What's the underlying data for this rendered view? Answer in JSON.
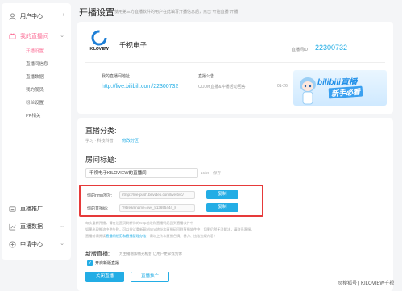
{
  "sidebar": {
    "groups": [
      {
        "label": "用户中心",
        "icon": "user-icon"
      },
      {
        "label": "我的直播间",
        "icon": "live-room-icon"
      }
    ],
    "sub_items": [
      "开播设置",
      "直播间信息",
      "直播数据",
      "我的舰员",
      "粉丝设置",
      "PK相关"
    ],
    "bottom_groups": [
      {
        "label": "直播推广",
        "icon": "promotion-icon"
      },
      {
        "label": "直播数据",
        "icon": "data-icon"
      },
      {
        "label": "申请中心",
        "icon": "apply-icon"
      }
    ]
  },
  "page": {
    "title": "开播设置",
    "desc": "使用第三方直播软件的用户在此填写开播信息后，点击“开始直播”开播"
  },
  "room": {
    "logo_text": "KILOVIEW",
    "name": "千视电子",
    "id_label": "直播间ID",
    "id": "22300732",
    "addr_label": "我的直播间地址",
    "addr": "http://live.bilibili.com/22300732",
    "notice_label": "直播公告",
    "notice_value": "CODM直播&冲播活动回答",
    "date": "01-26",
    "banner_title": "bilibili直播",
    "banner_sub": "新手必看"
  },
  "form": {
    "category_title": "直播分类:",
    "category_value": "学习 · 科技科普",
    "category_link": "修改分区",
    "room_title_label": "房间标题:",
    "room_title_value": "千视电子KILOVIEW的直播间",
    "title_count": "16/20",
    "title_save": "保存",
    "rtmp_label": "你的rtmp地址:",
    "rtmp_value": "rtmp://live-push.bilivideo.com/live-bvc/",
    "key_label": "你的直播码:",
    "key_value": "?streamname=live_513695444_8",
    "copy_label": "复制",
    "note1": "每次重新开播，请在设置页刷新你的rtmp地址和直播码后回到直播软件中",
    "note2": "如果出现推流中途失败，可以尝试重新复制rtmp地址和直播码回到直播软件中，如果仍然无法解决，请联系客服。",
    "note3_pre": "直播前请阅读",
    "note3_link": "直播间规范和直播管理办法",
    "note3_post": "，请勿上传和直播色情、暴力、违法违规内容！",
    "new_title": "新版直播:",
    "new_desc": "为主播增加畅光机会 让用户更早找到你",
    "checkbox_label": "开启新版直播",
    "close_button": "关闭直播",
    "promo_button": "直播推广"
  },
  "watermark": "@搜狐号 | KILOVIEW千视",
  "colors": {
    "accent_blue": "#23ade5",
    "accent_pink": "#fb7299",
    "highlight_red": "#e63a3a"
  }
}
